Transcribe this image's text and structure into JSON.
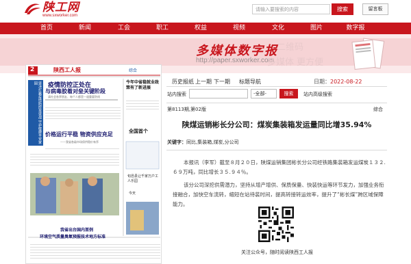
{
  "header": {
    "logo_text": "陕工网",
    "logo_url": "www.sxworker.com",
    "search_placeholder": "请输入要搜索的内容",
    "search_button": "搜索",
    "message_button": "留言板"
  },
  "nav": [
    "首页",
    "新闻",
    "工会",
    "职工",
    "权益",
    "视频",
    "文化",
    "图片",
    "数字报"
  ],
  "banner": {
    "title": "多媒体数字报",
    "url": "http://paper.sxworker.com",
    "ghost1": "二维码",
    "ghost2": "多媒体 更方便"
  },
  "paper": {
    "page_no": "2",
    "masthead": "陕西工人报",
    "section": "综合",
    "headline1": "疫情防控正处在",
    "headline2": "与病毒胶着对垒关键阶段",
    "subhead1": "请社会各界朋友、每个人都是一道重要防线",
    "left_bar": "坚决打赢疫情防控攻坚战 守护健康平安家园",
    "headline3": "价格运行平稳  物资供应充足",
    "subhead3": "——我省各级市场保供稳价有序",
    "right_headline": "今年中省稳就业政策有了新进展",
    "right_headline2": "全国首个",
    "bottom_headline1": "我省出台国内首例",
    "bottom_headline2": "环境空气质量臭氧预报技术地方标准",
    "right_text": "旬邑县让千家万户工人乐园",
    "right_small": "今天"
  },
  "tabs": [
    "历史报纸",
    "上一期",
    "下一期",
    "标题导航"
  ],
  "date_label": "日期：",
  "date_value": "2022-08-22",
  "site_search": {
    "label": "站内搜索",
    "select_value": "-全部-",
    "button": "搜索",
    "advanced": "站内高级搜索"
  },
  "version": {
    "left": "第8113期,第02版",
    "right": "综合"
  },
  "article": {
    "title": "陕煤运销彬长分公司：煤炭集装箱发运量同比增35.94%",
    "keywords_label": "关键字：",
    "keywords": "同比,集装箱,煤炭,分公司",
    "paragraphs": [
      "本报讯（李军）截至８月２０日，陕煤运销集团彬长分公司经铁路集装箱发运煤炭１３２.６９万吨，同比增长３５.９４％。",
      "该分公司深挖供需潜力，坚持从增产增供、保质保量、快装快运等环节发力，加强业务衔接融合，加快空车流转，缩短在站待装时间，提高转接转运效率，提升了“彬长煤”跨区域保障能力。"
    ],
    "qr_caption": "关注公众号，随时阅读陕西工人报"
  },
  "colors": {
    "brand_red": "#c8161d"
  }
}
